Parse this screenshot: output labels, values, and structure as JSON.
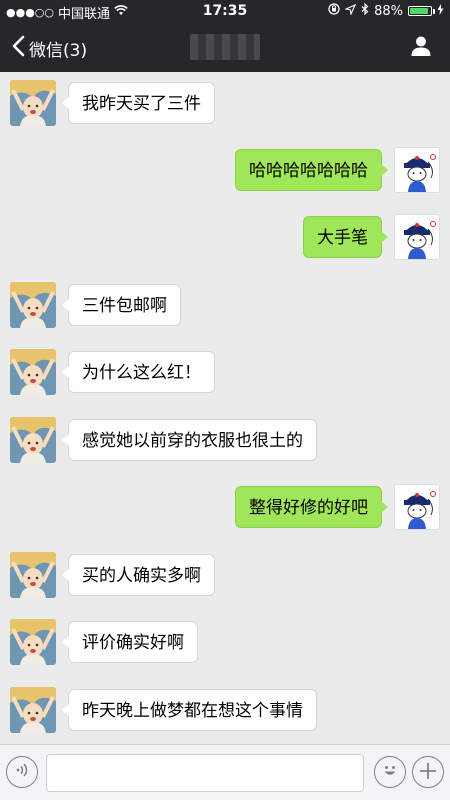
{
  "status_bar": {
    "signal": "●●●○○",
    "carrier": "中国联通",
    "time": "17:35",
    "battery_percent": "88%",
    "battery_level": 0.88
  },
  "nav": {
    "back_label": "微信(3)"
  },
  "messages": [
    {
      "side": "left",
      "text": "我昨天买了三件"
    },
    {
      "side": "right",
      "text": "哈哈哈哈哈哈哈"
    },
    {
      "side": "right",
      "text": "大手笔"
    },
    {
      "side": "left",
      "text": "三件包邮啊"
    },
    {
      "side": "left",
      "text": "为什么这么红！"
    },
    {
      "side": "left",
      "text": "感觉她以前穿的衣服也很土的"
    },
    {
      "side": "right",
      "text": "整得好修的好吧"
    },
    {
      "side": "left",
      "text": "买的人确实多啊"
    },
    {
      "side": "left",
      "text": "评价确实好啊"
    },
    {
      "side": "left",
      "text": "昨天晚上做梦都在想这个事情"
    }
  ],
  "input": {
    "value": "",
    "placeholder": ""
  },
  "icons": {
    "back": "chevron-left-icon",
    "profile": "person-icon",
    "voice": "voice-icon",
    "emoji": "emoji-icon",
    "plus": "plus-icon"
  },
  "colors": {
    "bar": "#27272b",
    "outgoing_bubble": "#9fe658",
    "incoming_bubble": "#ffffff",
    "background": "#ebebeb",
    "battery": "#4cd964"
  }
}
